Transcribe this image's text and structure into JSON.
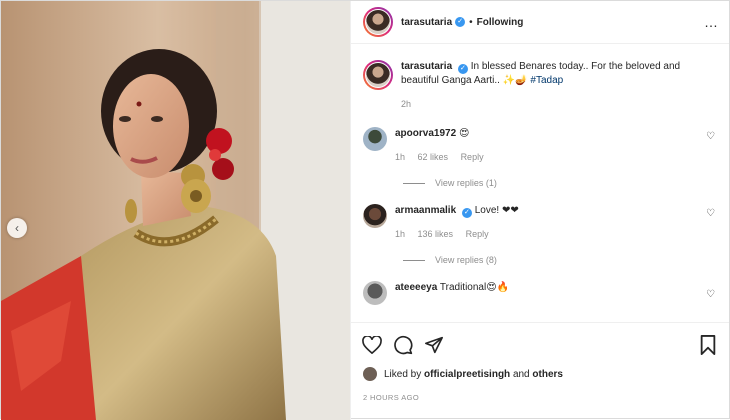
{
  "header": {
    "username": "tarasutaria",
    "verified_mark": "✓",
    "separator": "•",
    "follow_status": "Following",
    "more_icon": "…"
  },
  "photo": {
    "prev_icon": "‹"
  },
  "caption": {
    "username": "tarasutaria",
    "text": "In blessed Benares today.. For the beloved and beautiful Ganga Aarti.. ✨🪔",
    "hashtag": "#Tadap",
    "age": "2h"
  },
  "comments": [
    {
      "username": "apoorva1972",
      "text": "😍",
      "age": "1h",
      "likes": "62 likes",
      "reply": "Reply",
      "view_replies": "View replies (1)"
    },
    {
      "username": "armaanmalik",
      "verified": true,
      "text": "Love! ❤❤",
      "age": "1h",
      "likes": "136 likes",
      "reply": "Reply",
      "view_replies": "View replies (8)"
    },
    {
      "username": "ateeeeya",
      "text": "Traditional😍🔥"
    }
  ],
  "likes": {
    "prefix": "Liked by",
    "user": "officialpreetisingh",
    "connector": "and",
    "others": "others"
  },
  "timestamp": "2 HOURS AGO",
  "colors": {
    "verified": "#3897f0",
    "heart_red": "#ed4956",
    "border": "#dbdbdb"
  }
}
